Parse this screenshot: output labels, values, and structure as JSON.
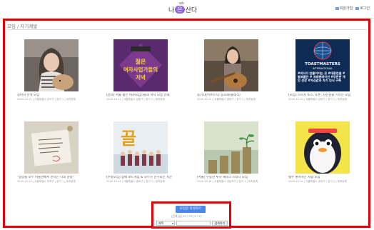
{
  "header": {
    "logo_left": "나",
    "logo_badge": "은",
    "logo_right": "산다",
    "logo_sup": "wk",
    "link1": "회원가입",
    "link2": "로그인"
  },
  "section": {
    "title": "모임 / 자기계발"
  },
  "cards": [
    {
      "caption": "강아지 산책 모임",
      "meta": "2020.10.11 | 서울특별시 강서구 | 참가 1 | 위치등록",
      "poster": ""
    },
    {
      "caption": "[강의] 서울 젊은 여자사업가들의 저녁 모임 안내",
      "meta": "2020.10.11 | 서울특별시 성동구 | 참가 2 | 위치등록",
      "poster_l1": "젊은",
      "poster_l2": "여자사업가들의",
      "poster_l3": "저녁"
    },
    {
      "caption": "통기타(어쿠스틱) 동호회(클래식)",
      "meta": "2020.10.12 | 서울특별시 중랑구 | 참가 1 | 위치등록",
      "poster": ""
    },
    {
      "caption": "[모임] 스피치 토스, 토론, 자신감을 기르는 모임",
      "meta": "2020.10.12 | 서울특별시 강남구 | 참가 1 | 위치등록",
      "poster_l1": "TOASTMASTERS",
      "poster_l2": "INTERNATIONAL",
      "poster_l3": "#리더가 만들어지는 곳 #대중연설 #발표불안 # 프레젠테이션 #무한한 개인 성장 #자신감과 자기 인식 구축"
    },
    {
      "caption": "\"일상을 모두 미술관에서 만나는 나의 감정\"",
      "meta": "2020.10.13 | 서울특별시 마포구 | 참가 1 | 위치등록",
      "poster": ""
    },
    {
      "caption": "[주말모임] 함께 보드게임 & 모두가 친구되는 시간",
      "meta": "2020.10.13 | 서울특별시 종로구 | 참가 1 | 위치등록",
      "poster_l1": "끌",
      "poster_l2": "",
      "poster_l3": ""
    },
    {
      "caption": "[서울] 부동산 투자 재테크 스터디 모임",
      "meta": "2020.10.14 | 서울특별시 영등포구 | 참가 1 | 위치등록",
      "poster": ""
    },
    {
      "caption": "펭수 좋아하는 사람 모임",
      "meta": "2020.10.14 | 서울특별시 송파구 | 참가 1 | 위치등록",
      "poster": ""
    }
  ],
  "pager": {
    "write_label": "모임글 작성하기",
    "page_info": "[전체 글] 23 | 23 [1 / 1]",
    "select_value": "제목",
    "search_value": "",
    "search_label": "검색하기"
  }
}
